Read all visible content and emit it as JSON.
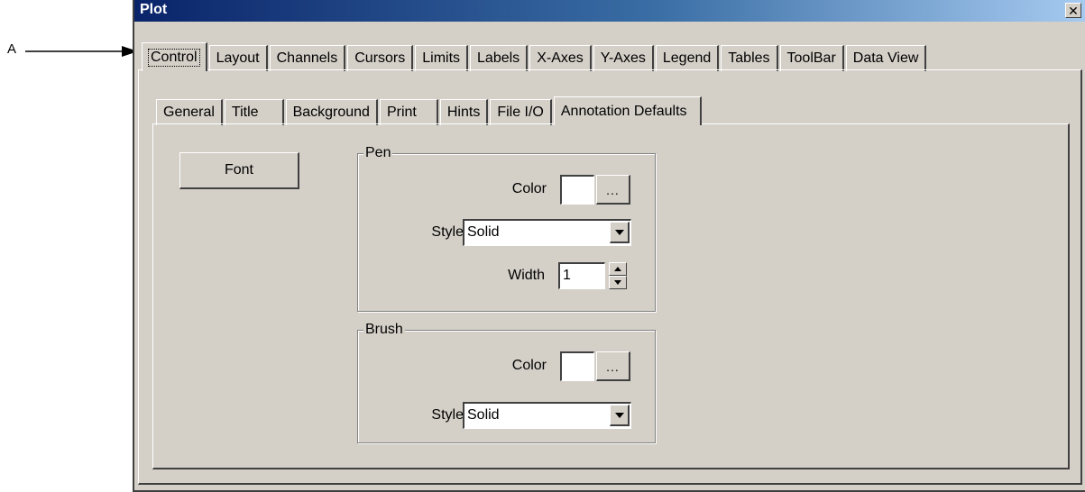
{
  "callout": {
    "label": "A"
  },
  "window": {
    "title": "Plot",
    "close_glyph": "✕"
  },
  "main_tabs": [
    {
      "label": "Control",
      "active": true
    },
    {
      "label": "Layout"
    },
    {
      "label": "Channels"
    },
    {
      "label": "Cursors"
    },
    {
      "label": "Limits"
    },
    {
      "label": "Labels"
    },
    {
      "label": "X-Axes"
    },
    {
      "label": "Y-Axes"
    },
    {
      "label": "Legend"
    },
    {
      "label": "Tables"
    },
    {
      "label": "ToolBar"
    },
    {
      "label": "Data View"
    }
  ],
  "sub_tabs": [
    {
      "label": "General"
    },
    {
      "label": "Title"
    },
    {
      "label": "Background"
    },
    {
      "label": "Print"
    },
    {
      "label": "Hints"
    },
    {
      "label": "File I/O"
    },
    {
      "label": "Annotation Defaults",
      "active": true
    }
  ],
  "font_button": {
    "label": "Font"
  },
  "pen": {
    "title": "Pen",
    "color_label": "Color",
    "color_value": "#ffffff",
    "color_button": "...",
    "style_label": "Style",
    "style_value": "Solid",
    "width_label": "Width",
    "width_value": "1"
  },
  "brush": {
    "title": "Brush",
    "color_label": "Color",
    "color_value": "#ffffff",
    "color_button": "...",
    "style_label": "Style",
    "style_value": "Solid"
  },
  "icons": {
    "dropdown": "chevron-down-icon",
    "spin_up": "spin-up-icon",
    "spin_down": "spin-down-icon"
  },
  "colors": {
    "titlebar_start": "#0a246a",
    "titlebar_end": "#a6caf0",
    "face": "#d4d0c8"
  }
}
